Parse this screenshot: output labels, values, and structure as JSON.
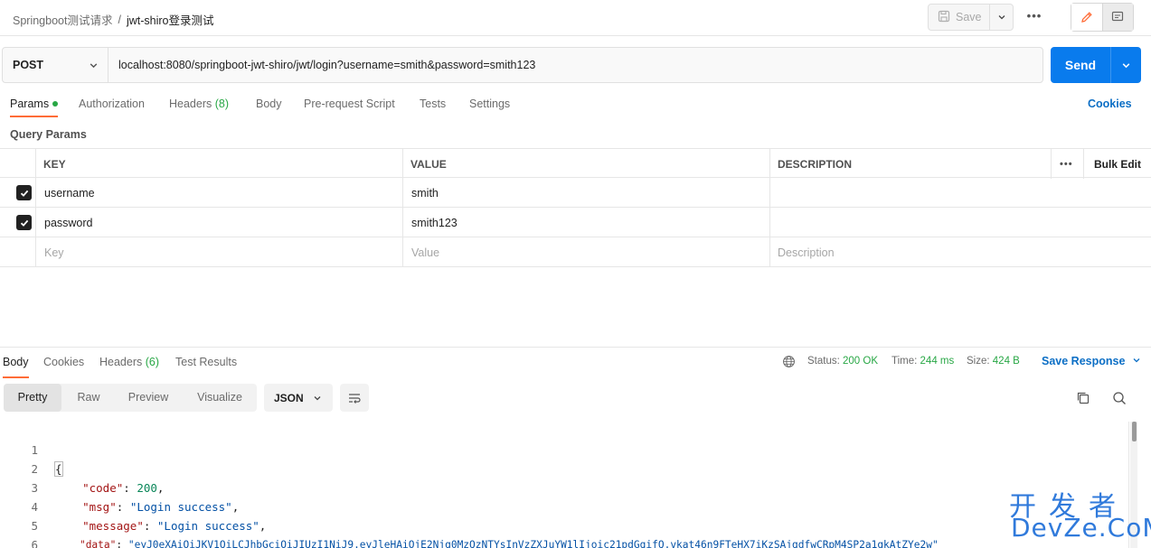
{
  "header": {
    "breadcrumb_parent": "Springboot测试请求",
    "breadcrumb_sep": "/",
    "breadcrumb_current": "jwt-shiro登录测试",
    "save_label": "Save"
  },
  "request": {
    "method": "POST",
    "url": "localhost:8080/springboot-jwt-shiro/jwt/login?username=smith&password=smith123",
    "send_label": "Send"
  },
  "request_tabs": {
    "params": "Params",
    "authorization": "Authorization",
    "headers": "Headers",
    "headers_count": "(8)",
    "body": "Body",
    "prerequest": "Pre-request Script",
    "tests": "Tests",
    "settings": "Settings",
    "cookies": "Cookies"
  },
  "params": {
    "title": "Query Params",
    "columns": {
      "key": "KEY",
      "value": "VALUE",
      "description": "DESCRIPTION",
      "bulk_edit": "Bulk Edit"
    },
    "rows": [
      {
        "key": "username",
        "value": "smith",
        "description": "",
        "checked": true
      },
      {
        "key": "password",
        "value": "smith123",
        "description": "",
        "checked": true
      }
    ],
    "placeholders": {
      "key": "Key",
      "value": "Value",
      "description": "Description"
    }
  },
  "response_tabs": {
    "body": "Body",
    "cookies": "Cookies",
    "headers": "Headers",
    "headers_count": "(6)",
    "test_results": "Test Results"
  },
  "response_status": {
    "status_label": "Status:",
    "status_value": "200 OK",
    "time_label": "Time:",
    "time_value": "244 ms",
    "size_label": "Size:",
    "size_value": "424 B",
    "save_response": "Save Response"
  },
  "view_modes": {
    "pretty": "Pretty",
    "raw": "Raw",
    "preview": "Preview",
    "visualize": "Visualize",
    "format": "JSON"
  },
  "response_body": {
    "line_numbers": [
      "1",
      "2",
      "3",
      "4",
      "5",
      "6"
    ],
    "open": "{",
    "close": "}",
    "code_key": "\"code\"",
    "code_value": "200",
    "msg_key": "\"msg\"",
    "msg_value": "\"Login success\"",
    "message_key": "\"message\"",
    "message_value": "\"Login success\"",
    "data_key": "\"data\"",
    "data_value": "\"eyJ0eXAiOiJKV1QiLCJhbGciOiJIUzI1NiJ9.eyJleHAiOjE2Njg0MzQzNTYsInVzZXJuYW1lIjoic21pdGgifQ.vkat46n9FTeHX7iKzSAjgdfwCRpM4SP2a1gkAtZYe2w\""
  },
  "watermark": {
    "cn": "开发者",
    "en": "DevZe.CoM"
  },
  "colors": {
    "accent": "#ff6c37",
    "primary": "#097bed",
    "success": "#28a745",
    "link": "#0b6ec5"
  }
}
